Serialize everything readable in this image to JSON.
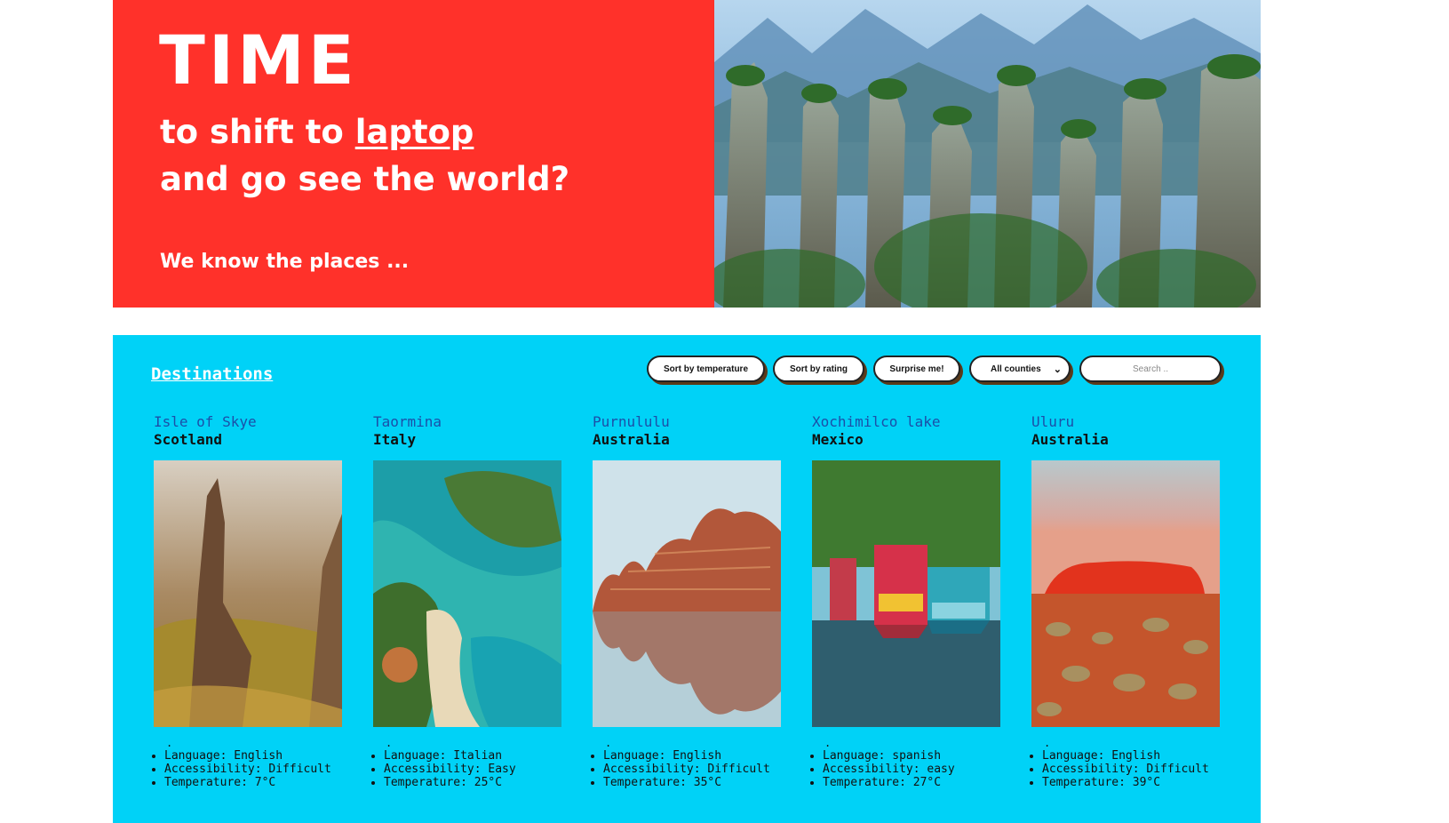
{
  "hero": {
    "title": "TIME",
    "line1_prefix": "to shift to ",
    "line1_link": "laptop",
    "line2": "and go see the world?",
    "tagline": "We know the places ..."
  },
  "destinations": {
    "heading": "Destinations",
    "controls": {
      "sort_temperature": "Sort by temperature",
      "sort_rating": "Sort by rating",
      "surprise": "Surprise me!",
      "country_select_value": "All counties",
      "search_placeholder": "Search .."
    },
    "cards": [
      {
        "name": "Isle of Skye",
        "country": "Scotland",
        "dot": ".",
        "language": "Language: English",
        "accessibility": "Accessibility: Difficult",
        "temperature": "Temperature: 7°C"
      },
      {
        "name": "Taormina",
        "country": "Italy",
        "dot": ".",
        "language": "Language: Italian",
        "accessibility": "Accessibility: Easy",
        "temperature": "Temperature: 25°C"
      },
      {
        "name": "Purnululu",
        "country": "Australia",
        "dot": ".",
        "language": "Language: English",
        "accessibility": "Accessibility: Difficult",
        "temperature": "Temperature: 35°C"
      },
      {
        "name": "Xochimilco lake",
        "country": "Mexico",
        "dot": ".",
        "language": "Language: spanish",
        "accessibility": "Accessibility: easy",
        "temperature": "Temperature: 27°C"
      },
      {
        "name": "Uluru",
        "country": "Australia",
        "dot": ".",
        "language": "Language: English",
        "accessibility": "Accessibility: Difficult",
        "temperature": "Temperature: 39°C"
      }
    ]
  },
  "colors": {
    "hero_red": "#ff312a",
    "dest_bg": "#00d2f7",
    "name_blue": "#1c4fa8"
  }
}
